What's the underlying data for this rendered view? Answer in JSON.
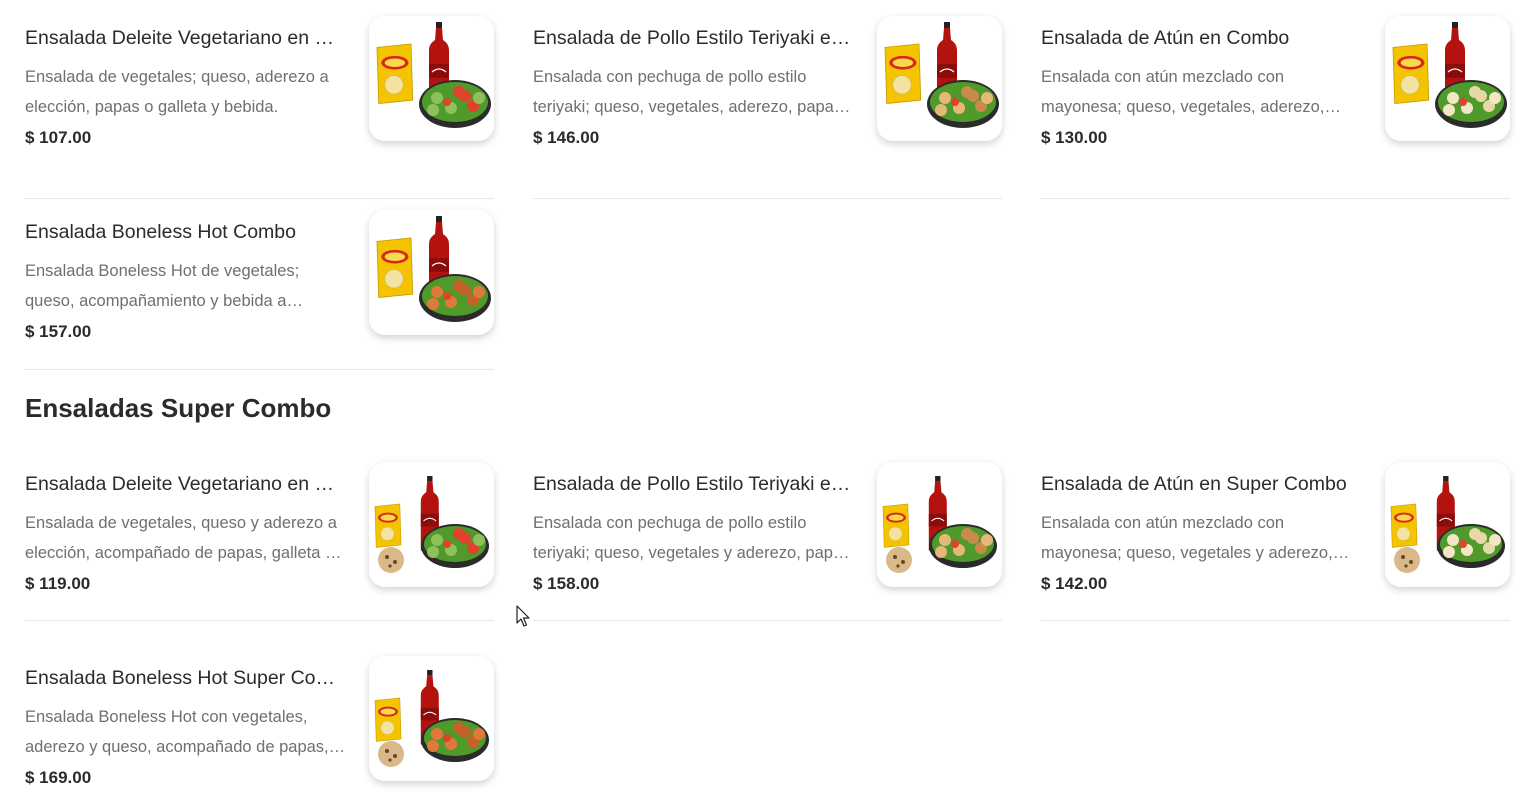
{
  "sections": [
    {
      "title": "",
      "items": [
        {
          "name": "Ensalada Deleite Vegetariano en Combo",
          "description": "Ensalada de vegetales; queso, aderezo a elección, papas o galleta y bebida.",
          "price": "$ 107.00",
          "image": "combo-vegetarian-salad-chips-soda"
        },
        {
          "name": "Ensalada de Pollo Estilo Teriyaki en Combo",
          "description": "Ensalada con pechuga de pollo estilo teriyaki; queso, vegetales, aderezo, papas o galleta y bebida.",
          "price": "$ 146.00",
          "image": "combo-teriyaki-salad-chips-soda"
        },
        {
          "name": "Ensalada de Atún en Combo",
          "description": "Ensalada con atún mezclado con mayonesa; queso, vegetales, aderezo, papas o galleta y bebida.",
          "price": "$ 130.00",
          "image": "combo-tuna-salad-chips-soda"
        },
        {
          "name": "Ensalada Boneless Hot Combo",
          "description": "Ensalada Boneless Hot de vegetales; queso, acompañamiento y bebida a elección.",
          "price": "$ 157.00",
          "image": "combo-boneless-salad-chips-soda"
        }
      ]
    },
    {
      "title": "Ensaladas Super Combo",
      "items": [
        {
          "name": "Ensalada Deleite Vegetariano en Super Combo",
          "description": "Ensalada de vegetales, queso y aderezo a elección, acompañado de papas, galleta y bebida.",
          "price": "$ 119.00",
          "image": "supercombo-vegetarian-salad"
        },
        {
          "name": "Ensalada de Pollo Estilo Teriyaki en Super Combo",
          "description": "Ensalada con pechuga de pollo estilo teriyaki; queso, vegetales y aderezo, papas, galleta y bebida.",
          "price": "$ 158.00",
          "image": "supercombo-teriyaki-salad"
        },
        {
          "name": "Ensalada de Atún en Super Combo",
          "description": "Ensalada con atún mezclado con mayonesa; queso, vegetales y aderezo, papas, galleta y bebida.",
          "price": "$ 142.00",
          "image": "supercombo-tuna-salad"
        },
        {
          "name": "Ensalada Boneless Hot Super Combo",
          "description": "Ensalada Boneless Hot con vegetales, aderezo y queso, acompañado de papas, galleta y bebida.",
          "price": "$ 169.00",
          "image": "supercombo-boneless-salad"
        }
      ]
    }
  ],
  "colors": {
    "text": "#2b2b2b",
    "muted": "#6f6f6f",
    "divider": "#e8e8e8",
    "chips": "#f5c400",
    "chips_red": "#d6281c",
    "soda": "#b3120f",
    "lettuce": "#4f9a2a",
    "tomato": "#e0432b"
  }
}
